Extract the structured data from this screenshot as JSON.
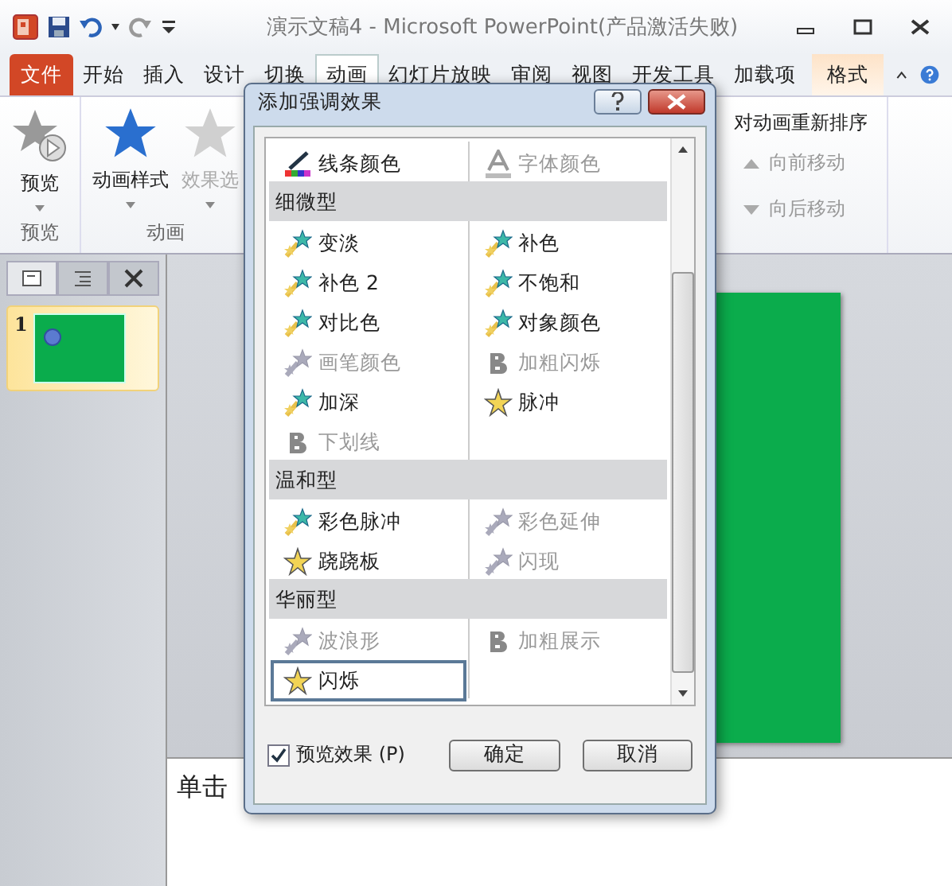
{
  "window": {
    "title": "演示文稿4 - Microsoft PowerPoint(产品激活失败)"
  },
  "tabs": [
    {
      "label": "文件",
      "kind": "file",
      "selected": false
    },
    {
      "label": "开始",
      "kind": "normal",
      "selected": false
    },
    {
      "label": "插入",
      "kind": "normal",
      "selected": false
    },
    {
      "label": "设计",
      "kind": "normal",
      "selected": false
    },
    {
      "label": "切换",
      "kind": "normal",
      "selected": false
    },
    {
      "label": "动画",
      "kind": "normal",
      "selected": true
    },
    {
      "label": "幻灯片放映",
      "kind": "normal",
      "selected": false
    },
    {
      "label": "审阅",
      "kind": "normal",
      "selected": false
    },
    {
      "label": "视图",
      "kind": "normal",
      "selected": false
    },
    {
      "label": "开发工具",
      "kind": "normal",
      "selected": false
    },
    {
      "label": "加载项",
      "kind": "normal",
      "selected": false
    },
    {
      "label": "格式",
      "kind": "context",
      "selected": false
    }
  ],
  "ribbon": {
    "groups": [
      {
        "label": "预览",
        "buttons": [
          {
            "label": "预览",
            "kind": "preview",
            "disabled": false
          }
        ]
      },
      {
        "label": "动画",
        "buttons": [
          {
            "label": "动画样式",
            "kind": "star",
            "disabled": false
          },
          {
            "label": "效果选",
            "kind": "star",
            "disabled": true
          }
        ]
      }
    ],
    "reorder": {
      "title": "对动画重新排序",
      "buttons": [
        {
          "label": "向前移动",
          "kind": "up",
          "disabled": true
        },
        {
          "label": "向后移动",
          "kind": "down",
          "disabled": true
        }
      ]
    }
  },
  "slides_pane": {
    "slides": [
      {
        "number": "1",
        "selected": true
      }
    ]
  },
  "notes": {
    "text": "单击"
  },
  "dialog": {
    "title": "添加强调效果",
    "rows": [
      {
        "kind": "items",
        "items": [
          {
            "label": "线条颜色",
            "kind": "brush",
            "disabled": false,
            "selected": false
          },
          {
            "label": "字体颜色",
            "kind": "font",
            "disabled": true,
            "selected": false
          }
        ]
      },
      {
        "kind": "header",
        "label": "细微型"
      },
      {
        "kind": "items",
        "items": [
          {
            "label": "变淡",
            "kind": "star",
            "disabled": false,
            "selected": false
          },
          {
            "label": "补色",
            "kind": "star",
            "disabled": false,
            "selected": false
          }
        ]
      },
      {
        "kind": "items",
        "items": [
          {
            "label": "补色 2",
            "kind": "star",
            "disabled": false,
            "selected": false
          },
          {
            "label": "不饱和",
            "kind": "star",
            "disabled": false,
            "selected": false
          }
        ]
      },
      {
        "kind": "items",
        "items": [
          {
            "label": "对比色",
            "kind": "star",
            "disabled": false,
            "selected": false
          },
          {
            "label": "对象颜色",
            "kind": "star",
            "disabled": false,
            "selected": false
          }
        ]
      },
      {
        "kind": "items",
        "items": [
          {
            "label": "画笔颜色",
            "kind": "star",
            "disabled": true,
            "selected": false
          },
          {
            "label": "加粗闪烁",
            "kind": "bold",
            "disabled": true,
            "selected": false
          }
        ]
      },
      {
        "kind": "items",
        "items": [
          {
            "label": "加深",
            "kind": "star",
            "disabled": false,
            "selected": false
          },
          {
            "label": "脉冲",
            "kind": "sparkle",
            "disabled": false,
            "selected": false
          }
        ]
      },
      {
        "kind": "items",
        "items": [
          {
            "label": "下划线",
            "kind": "bold",
            "disabled": true,
            "selected": false
          }
        ]
      },
      {
        "kind": "header",
        "label": "温和型"
      },
      {
        "kind": "items",
        "items": [
          {
            "label": "彩色脉冲",
            "kind": "star",
            "disabled": false,
            "selected": false
          },
          {
            "label": "彩色延伸",
            "kind": "star",
            "disabled": true,
            "selected": false
          }
        ]
      },
      {
        "kind": "items",
        "items": [
          {
            "label": "跷跷板",
            "kind": "sparkle",
            "disabled": false,
            "selected": false
          },
          {
            "label": "闪现",
            "kind": "star",
            "disabled": true,
            "selected": false
          }
        ]
      },
      {
        "kind": "header",
        "label": "华丽型"
      },
      {
        "kind": "items",
        "items": [
          {
            "label": "波浪形",
            "kind": "star",
            "disabled": true,
            "selected": false
          },
          {
            "label": "加粗展示",
            "kind": "bold",
            "disabled": true,
            "selected": false
          }
        ]
      },
      {
        "kind": "items",
        "items": [
          {
            "label": "闪烁",
            "kind": "sparkle",
            "disabled": false,
            "selected": true
          }
        ]
      }
    ],
    "preview": {
      "label": "预览效果 (P)",
      "checked": true
    },
    "buttons": [
      "确定",
      "取消"
    ]
  }
}
